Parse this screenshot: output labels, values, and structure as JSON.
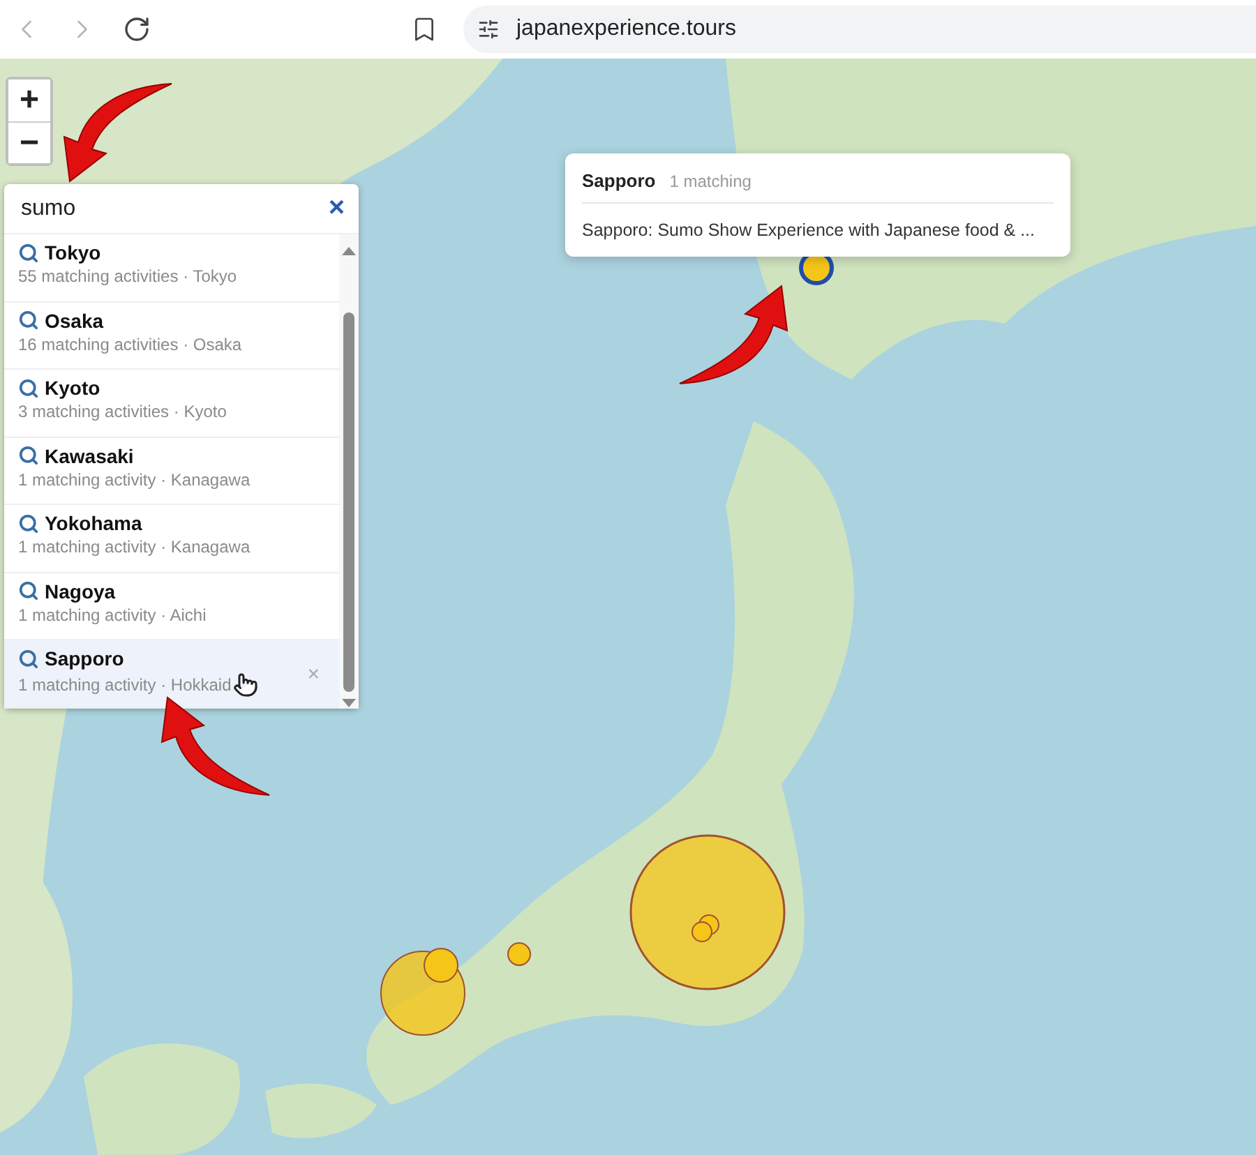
{
  "browser": {
    "back_disabled": true,
    "forward_disabled": true,
    "url": "japanexperience.tours"
  },
  "zoom_controls": [
    "+",
    "−"
  ],
  "search": {
    "value": "sumo",
    "clear": "×"
  },
  "results": [
    {
      "name": "Tokyo",
      "count": "55 matching activities",
      "region": "Tokyo",
      "selected": false
    },
    {
      "name": "Osaka",
      "count": "16 matching activities",
      "region": "Osaka",
      "selected": false
    },
    {
      "name": "Kyoto",
      "count": "3 matching activities",
      "region": "Kyoto",
      "selected": false
    },
    {
      "name": "Kawasaki",
      "count": "1 matching activity",
      "region": "Kanagawa",
      "selected": false
    },
    {
      "name": "Yokohama",
      "count": "1 matching activity",
      "region": "Kanagawa",
      "selected": false
    },
    {
      "name": "Nagoya",
      "count": "1 matching activity",
      "region": "Aichi",
      "selected": false
    },
    {
      "name": "Sapporo",
      "count": "1 matching activity",
      "region": "Hokkaid",
      "selected": true,
      "remove": "×"
    }
  ],
  "separator": "·",
  "popup": {
    "title": "Sapporo",
    "count": "1 matching",
    "activity": "Sapporo: Sumo Show Experience with Japanese food & ..."
  }
}
